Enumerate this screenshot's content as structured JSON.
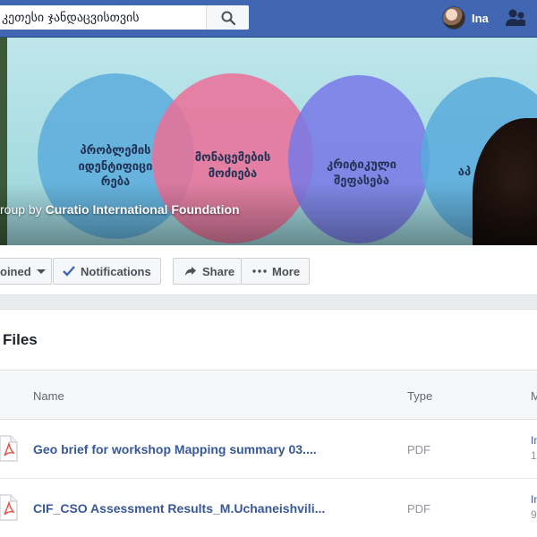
{
  "search": {
    "value": "კეთესი ჯანდაცვისთვის"
  },
  "header": {
    "profile_name": "Ina"
  },
  "cover": {
    "circles": [
      {
        "label": "პრობლემის იდენტიფიცი რება"
      },
      {
        "label": "მონაცემების მოძიება"
      },
      {
        "label": "კრიტიკული შეფასება"
      },
      {
        "label": "აპ"
      }
    ],
    "caption_prefix": "roup by",
    "caption_org": "Curatio International Foundation"
  },
  "actions": {
    "joined_label": "oined",
    "notifications_label": "Notifications",
    "share_label": "Share",
    "more_label": "More"
  },
  "files": {
    "title": "Files",
    "columns": {
      "name": "Name",
      "type": "Type",
      "m": "M"
    },
    "rows": [
      {
        "name": "Geo brief for workshop Mapping summary 03....",
        "type": "PDF",
        "meta_a": "In",
        "meta_b": "1"
      },
      {
        "name": "CIF_CSO Assessment Results_M.Uchaneishvili...",
        "type": "PDF",
        "meta_a": "In",
        "meta_b": "9"
      }
    ]
  },
  "colors": {
    "brand": "#4267b2",
    "link": "#385898",
    "pdf_red": "#e2574c"
  }
}
